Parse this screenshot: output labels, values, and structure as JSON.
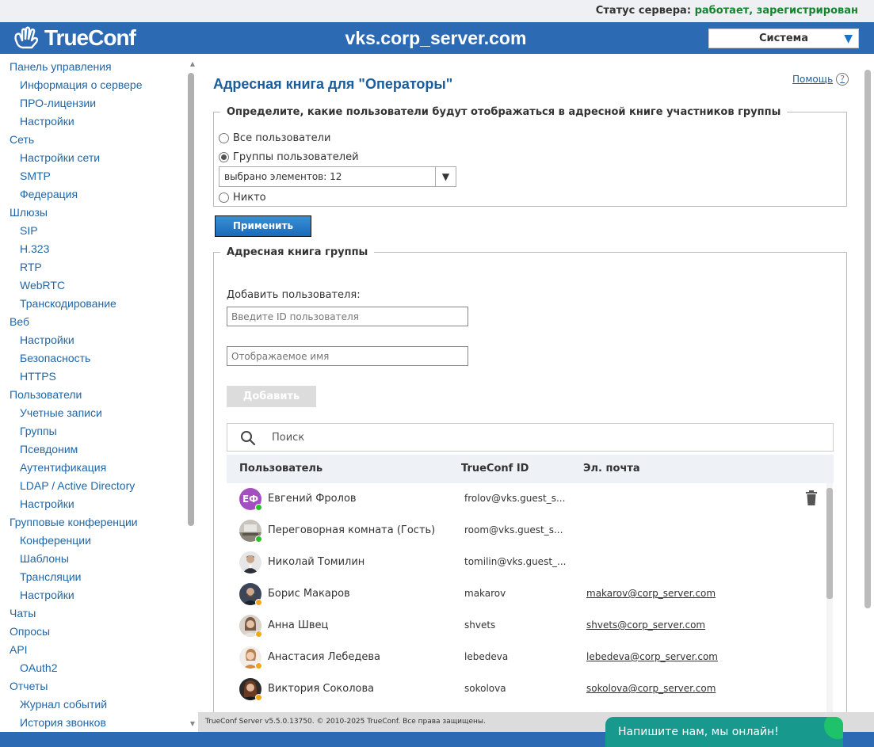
{
  "status": {
    "label": "Статус сервера:",
    "value": "работает, зарегистрирован",
    "ok_color": "#14852b"
  },
  "header": {
    "logo_text": "TrueConf",
    "server_name": "vks.corp_server.com",
    "system_select": "Система",
    "bg_color": "#2d6ab4"
  },
  "sidebar": {
    "items": [
      {
        "label": "Панель управления",
        "level": 1
      },
      {
        "label": "Информация о сервере",
        "level": 2
      },
      {
        "label": "ПРО-лицензии",
        "level": 2
      },
      {
        "label": "Настройки",
        "level": 2
      },
      {
        "label": "Сеть",
        "level": 1
      },
      {
        "label": "Настройки сети",
        "level": 2
      },
      {
        "label": "SMTP",
        "level": 2
      },
      {
        "label": "Федерация",
        "level": 2
      },
      {
        "label": "Шлюзы",
        "level": 1
      },
      {
        "label": "SIP",
        "level": 2
      },
      {
        "label": "H.323",
        "level": 2
      },
      {
        "label": "RTP",
        "level": 2
      },
      {
        "label": "WebRTC",
        "level": 2
      },
      {
        "label": "Транскодирование",
        "level": 2
      },
      {
        "label": "Веб",
        "level": 1
      },
      {
        "label": "Настройки",
        "level": 2
      },
      {
        "label": "Безопасность",
        "level": 2
      },
      {
        "label": "HTTPS",
        "level": 2
      },
      {
        "label": "Пользователи",
        "level": 1
      },
      {
        "label": "Учетные записи",
        "level": 2
      },
      {
        "label": "Группы",
        "level": 2
      },
      {
        "label": "Псевдоним",
        "level": 2
      },
      {
        "label": "Аутентификация",
        "level": 2
      },
      {
        "label": "LDAP / Active Directory",
        "level": 2
      },
      {
        "label": "Настройки",
        "level": 2
      },
      {
        "label": "Групповые конференции",
        "level": 1
      },
      {
        "label": "Конференции",
        "level": 2
      },
      {
        "label": "Шаблоны",
        "level": 2
      },
      {
        "label": "Трансляции",
        "level": 2
      },
      {
        "label": "Настройки",
        "level": 2
      },
      {
        "label": "Чаты",
        "level": 1
      },
      {
        "label": "Опросы",
        "level": 1
      },
      {
        "label": "API",
        "level": 1
      },
      {
        "label": "OAuth2",
        "level": 2
      },
      {
        "label": "Отчеты",
        "level": 1
      },
      {
        "label": "Журнал событий",
        "level": 2
      },
      {
        "label": "История звонков",
        "level": 2
      }
    ]
  },
  "main": {
    "title": "Адресная книга для \"Операторы\"",
    "help": "Помощь",
    "visibility": {
      "legend": "Определите, какие пользователи будут отображаться в адресной книге участников группы",
      "opt_all": "Все пользователи",
      "opt_groups": "Группы пользователей",
      "groups_select": "выбрано элементов: 12",
      "opt_none": "Никто",
      "apply": "Применить"
    },
    "addressbook": {
      "legend": "Адресная книга группы",
      "add_label": "Добавить пользователя:",
      "id_placeholder": "Введите ID пользователя",
      "name_placeholder": "Отображаемое имя",
      "add_button": "Добавить",
      "search_placeholder": "Поиск",
      "columns": {
        "user": "Пользователь",
        "id": "TrueConf ID",
        "email": "Эл. почта"
      },
      "rows": [
        {
          "name": "Евгений Фролов",
          "id": "frolov@vks.guest_s...",
          "email": "",
          "initials": "ЕФ",
          "status": "#2ec02e",
          "avatar": "initials"
        },
        {
          "name": "Переговорная комната (Гость)",
          "id": "room@vks.guest_s...",
          "email": "",
          "status": "#2ec02e",
          "avatar": "room"
        },
        {
          "name": "Николай Томилин",
          "id": "tomilin@vks.guest_...",
          "email": "",
          "status": "",
          "avatar": "man"
        },
        {
          "name": "Борис Макаров",
          "id": "makarov",
          "email": "makarov@corp_server.com",
          "status": "#f0a818",
          "avatar": "man2"
        },
        {
          "name": "Анна Швец",
          "id": "shvets",
          "email": "shvets@corp_server.com",
          "status": "#f0a818",
          "avatar": "woman"
        },
        {
          "name": "Анастасия Лебедева",
          "id": "lebedeva",
          "email": "lebedeva@corp_server.com",
          "status": "#f0a818",
          "avatar": "woman2"
        },
        {
          "name": "Виктория Соколова",
          "id": "sokolova",
          "email": "sokolova@corp_server.com",
          "status": "#f0a818",
          "avatar": "woman3"
        }
      ]
    }
  },
  "footer": {
    "copyright": "TrueConf Server v5.5.0.13750. © 2010-2025 TrueConf. Все права защищены."
  },
  "chat": {
    "label": "Напишите нам, мы онлайн!"
  }
}
